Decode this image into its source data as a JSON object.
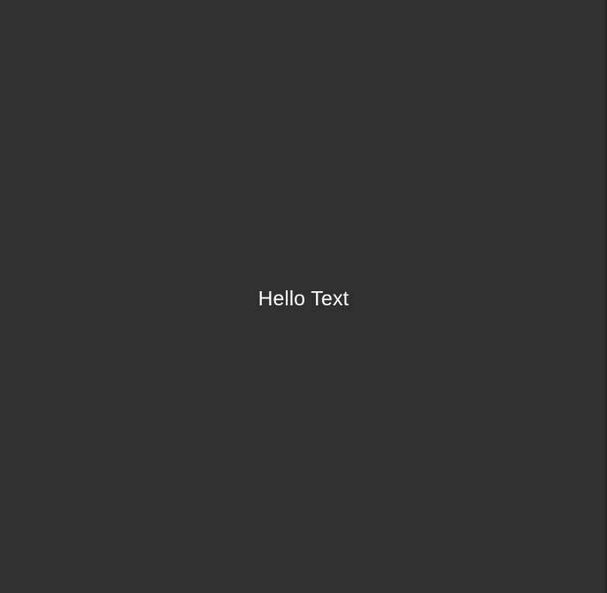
{
  "screen": {
    "background_color": "#303030",
    "edge_color": "#262626"
  },
  "center_text": {
    "text": "Hello Text",
    "color": "#ffffff"
  }
}
